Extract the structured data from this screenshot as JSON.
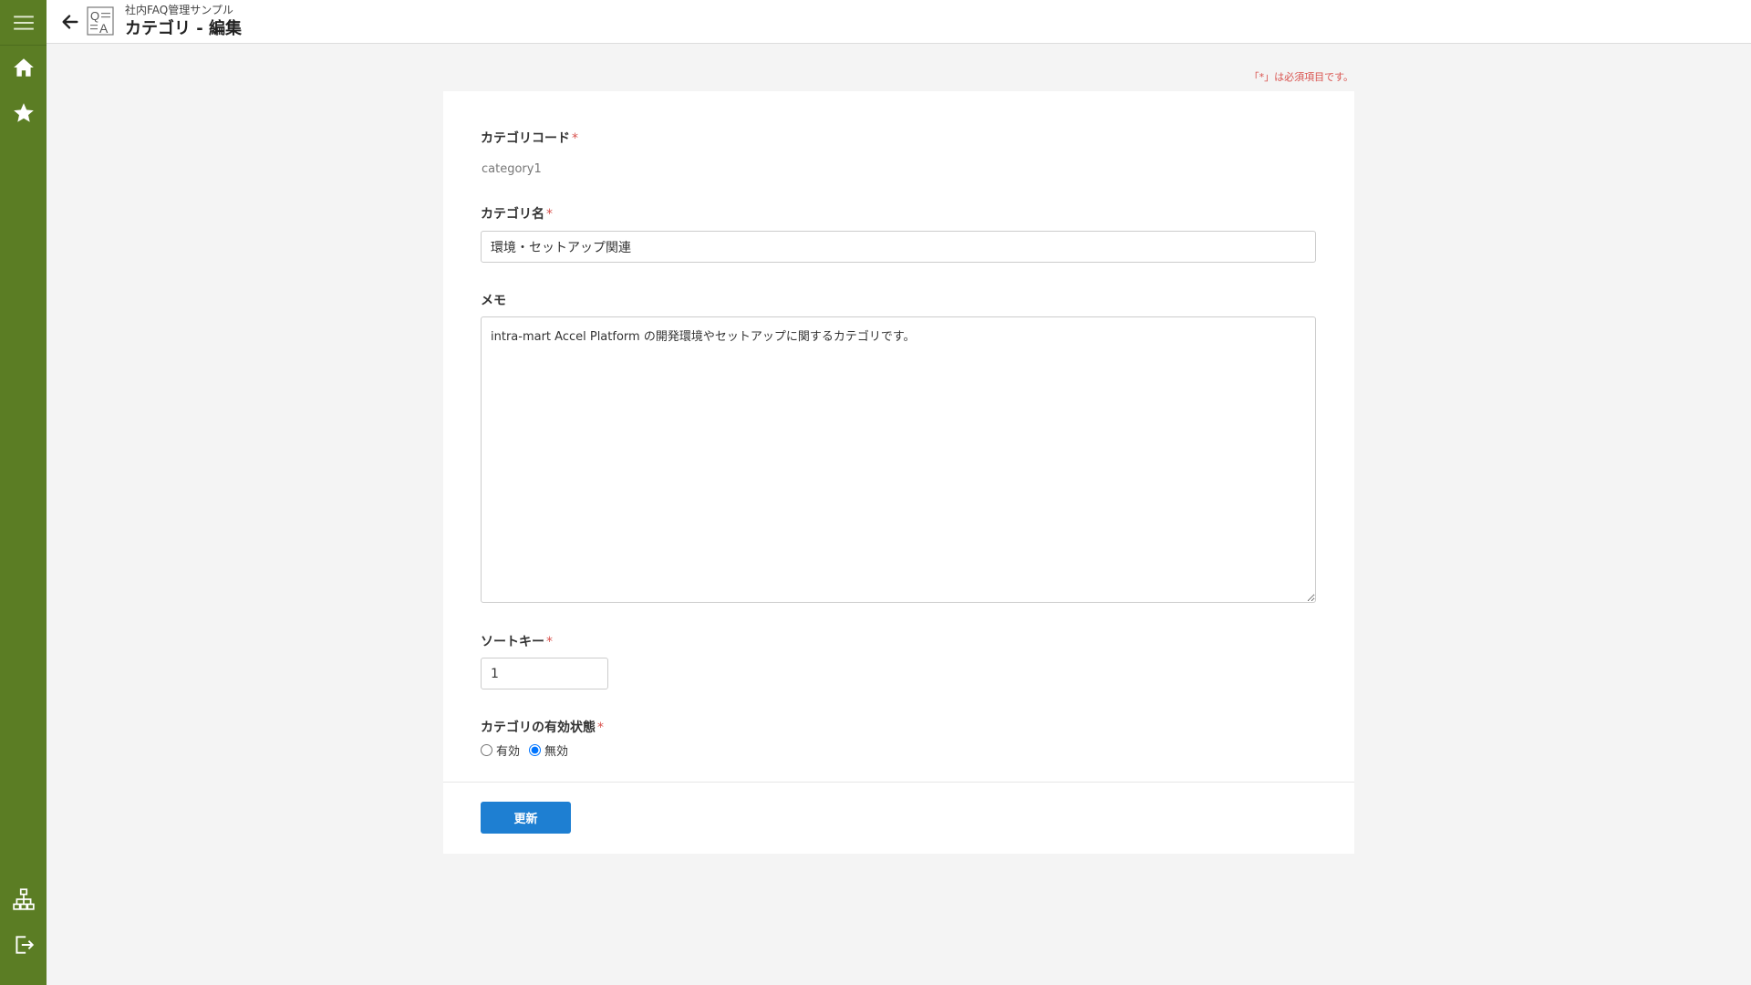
{
  "header": {
    "app_name": "社内FAQ管理サンプル",
    "title": "カテゴリ - 編集"
  },
  "required_note": "「*」は必須項目です。",
  "form": {
    "code": {
      "label": "カテゴリコード",
      "required": "*",
      "value": "category1"
    },
    "name": {
      "label": "カテゴリ名",
      "required": "*",
      "value": "環境・セットアップ関連"
    },
    "memo": {
      "label": "メモ",
      "value": "intra-mart Accel Platform の開発環境やセットアップに関するカテゴリです。"
    },
    "sort_key": {
      "label": "ソートキー",
      "required": "*",
      "value": "1"
    },
    "status": {
      "label": "カテゴリの有効状態",
      "required": "*",
      "options": [
        "有効",
        "無効"
      ],
      "selected": "無効"
    },
    "submit_label": "更新"
  },
  "colors": {
    "sidebar": "#5b7d24",
    "primary_button": "#1e7fd2",
    "required": "#d9534f"
  },
  "icons": {
    "sidebar_top": [
      "menu-icon",
      "home-icon",
      "star-icon"
    ],
    "sidebar_bottom": [
      "sitemap-icon",
      "logout-icon"
    ],
    "header": [
      "back-arrow-icon",
      "qa-app-icon"
    ]
  }
}
